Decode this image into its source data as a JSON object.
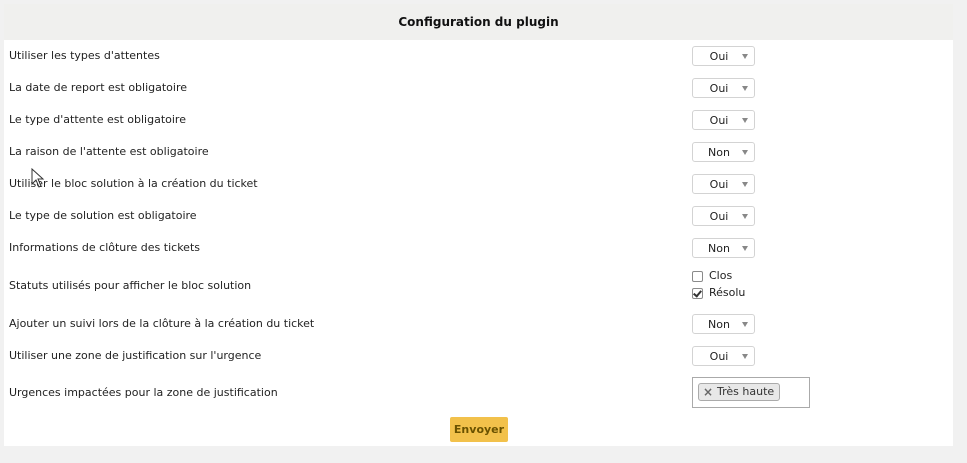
{
  "header": {
    "title": "Configuration du plugin"
  },
  "settings": [
    {
      "label": "Utiliser les types d'attentes",
      "value": "Oui"
    },
    {
      "label": "La date de report est obligatoire",
      "value": "Oui"
    },
    {
      "label": "Le type d'attente est obligatoire",
      "value": "Oui"
    },
    {
      "label": "La raison de l'attente est obligatoire",
      "value": "Non"
    },
    {
      "label": "Utiliser le bloc solution à la création du ticket",
      "value": "Oui"
    },
    {
      "label": "Le type de solution est obligatoire",
      "value": "Oui"
    },
    {
      "label": "Informations de clôture des tickets",
      "value": "Non"
    },
    {
      "label": "Statuts utilisés pour afficher le bloc solution"
    },
    {
      "label": "Ajouter un suivi lors de la clôture à la création du ticket",
      "value": "Non"
    },
    {
      "label": "Utiliser une zone de justification sur l'urgence",
      "value": "Oui"
    },
    {
      "label": "Urgences impactées pour la zone de justification"
    }
  ],
  "statuses": [
    {
      "label": "Clos",
      "checked": false
    },
    {
      "label": "Résolu",
      "checked": true
    }
  ],
  "urgencies": {
    "tags": [
      "Très haute"
    ]
  },
  "submit": {
    "label": "Envoyer"
  }
}
